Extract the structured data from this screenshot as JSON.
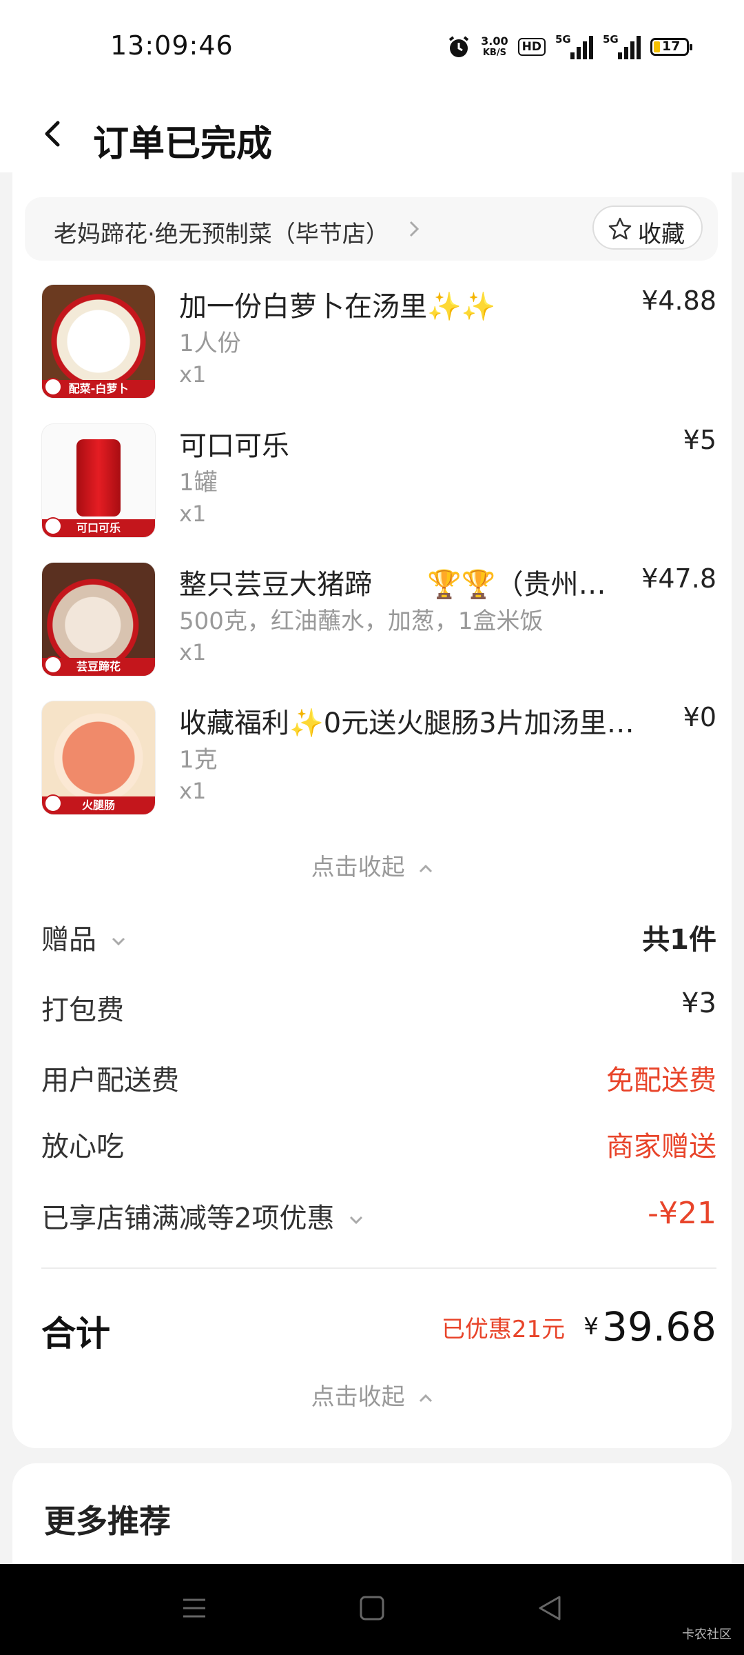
{
  "status": {
    "time": "13:09:46",
    "net_speed_value": "3.00",
    "net_speed_unit": "KB/S",
    "hd": "HD",
    "signal1": "5G",
    "signal2": "5G",
    "battery": "17"
  },
  "header": {
    "title": "订单已完成"
  },
  "shop": {
    "name": "老妈蹄花·绝无预制菜（毕节店）",
    "favorite_label": "收藏"
  },
  "items": [
    {
      "name": "加一份白萝卜在汤里✨✨",
      "spec": "1人份",
      "qty": "x1",
      "price": "¥4.88",
      "thumb_label": "配菜-白萝卜",
      "thumb_style": "radish"
    },
    {
      "name": "可口可乐",
      "spec": "1罐",
      "qty": "x1",
      "price": "¥5",
      "thumb_label": "可口可乐",
      "thumb_style": "coke"
    },
    {
      "name": "整只芸豆大猪蹄　　🏆🏆（贵州…",
      "spec": "500克，红油蘸水，加葱，1盒米饭",
      "qty": "x1",
      "price": "¥47.8",
      "thumb_label": "芸豆蹄花",
      "thumb_style": "trotter"
    },
    {
      "name": "收藏福利✨0元送火腿肠3片加汤里…",
      "spec": "1克",
      "qty": "x1",
      "price": "¥0",
      "thumb_label": "火腿肠",
      "thumb_style": "ham"
    }
  ],
  "collapse_label": "点击收起",
  "fees": {
    "gift_label": "赠品",
    "gift_value": "共1件",
    "packing_label": "打包费",
    "packing_value": "¥3",
    "delivery_label": "用户配送费",
    "delivery_value": "免配送费",
    "safe_label": "放心吃",
    "safe_value": "商家赠送",
    "discount_label": "已享店铺满减等2项优惠",
    "discount_value": "-¥21"
  },
  "total": {
    "label": "合计",
    "saved": "已优惠21元",
    "currency": "¥",
    "amount": "39.68"
  },
  "more": {
    "title": "更多推荐"
  },
  "watermark": "卡农社区",
  "colors": {
    "accent_red": "#e8442a",
    "thumb_banner": "#c4161c"
  }
}
